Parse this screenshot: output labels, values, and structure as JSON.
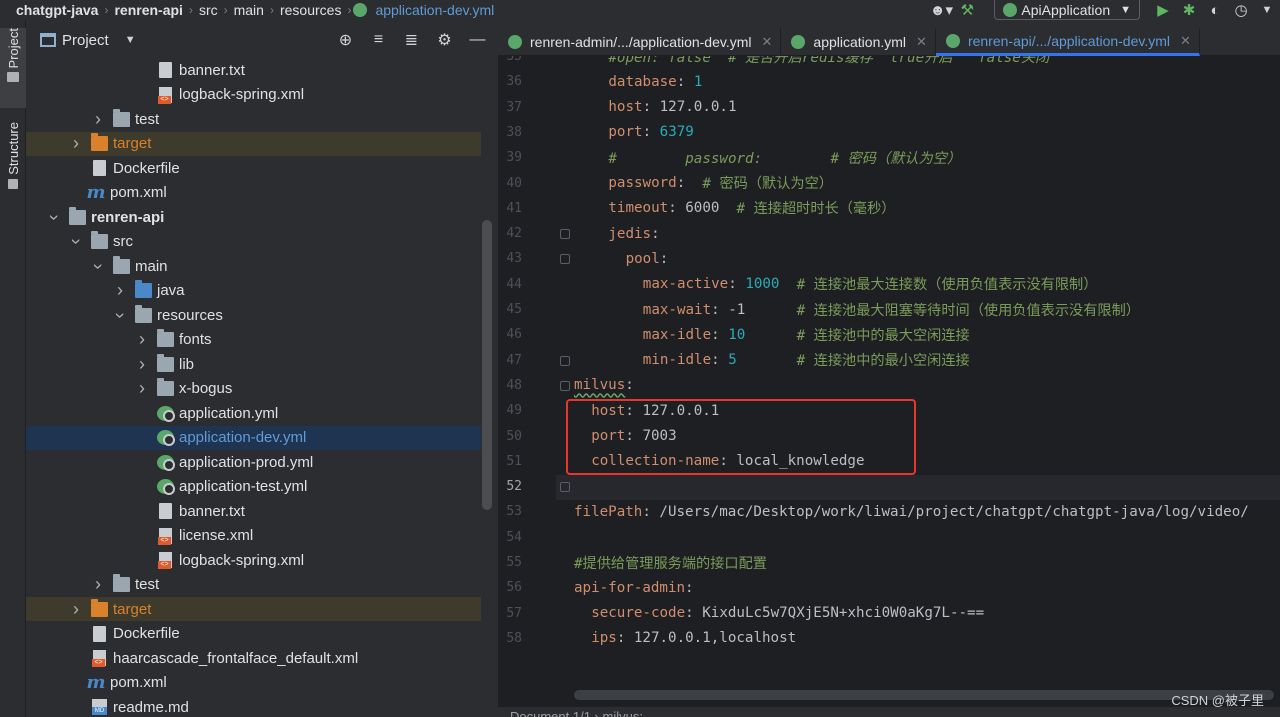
{
  "breadcrumb": [
    {
      "label": "chatgpt-java",
      "bold": true
    },
    {
      "label": "renren-api",
      "bold": true
    },
    {
      "label": "src"
    },
    {
      "label": "main"
    },
    {
      "label": "resources"
    },
    {
      "label": "application-dev.yml",
      "active": true
    }
  ],
  "toolbar": {
    "run_config": "ApiApplication",
    "icons": [
      "user-icon",
      "build-hammer-icon",
      "run-icon",
      "debug-icon",
      "coverage-icon",
      "profiler-icon",
      "more-icon"
    ]
  },
  "left_strip": {
    "project_label": "Project",
    "structure_label": "Structure"
  },
  "project_panel": {
    "title": "Project",
    "tools": [
      "locate-icon",
      "expand-all-icon",
      "collapse-all-icon",
      "settings-icon",
      "hide-icon"
    ]
  },
  "tree": [
    {
      "label": "banner.txt",
      "icon": "text-file-icon",
      "indent": 5,
      "arrow": ""
    },
    {
      "label": "logback-spring.xml",
      "icon": "xml-file-icon",
      "indent": 5,
      "arrow": ""
    },
    {
      "label": "test",
      "icon": "folder-icon",
      "indent": 3,
      "arrow": "right"
    },
    {
      "label": "target",
      "icon": "folder-orange-icon",
      "indent": 2,
      "arrow": "right",
      "style": "orange"
    },
    {
      "label": "Dockerfile",
      "icon": "dockerfile-icon",
      "indent": 2,
      "arrow": ""
    },
    {
      "label": "pom.xml",
      "icon": "maven-icon",
      "indent": 2,
      "arrow": ""
    },
    {
      "label": "renren-api",
      "icon": "module-folder-icon",
      "indent": 1,
      "arrow": "down",
      "bold": true
    },
    {
      "label": "src",
      "icon": "folder-icon",
      "indent": 2,
      "arrow": "down"
    },
    {
      "label": "main",
      "icon": "folder-icon",
      "indent": 3,
      "arrow": "down"
    },
    {
      "label": "java",
      "icon": "source-folder-icon",
      "indent": 4,
      "arrow": "right"
    },
    {
      "label": "resources",
      "icon": "resources-folder-icon",
      "indent": 4,
      "arrow": "down"
    },
    {
      "label": "fonts",
      "icon": "folder-icon",
      "indent": 5,
      "arrow": "right"
    },
    {
      "label": "lib",
      "icon": "folder-icon",
      "indent": 5,
      "arrow": "right"
    },
    {
      "label": "x-bogus",
      "icon": "folder-icon",
      "indent": 5,
      "arrow": "right"
    },
    {
      "label": "application.yml",
      "icon": "spring-yml-icon",
      "indent": 5,
      "arrow": ""
    },
    {
      "label": "application-dev.yml",
      "icon": "spring-yml-icon",
      "indent": 5,
      "arrow": "",
      "selected": true
    },
    {
      "label": "application-prod.yml",
      "icon": "spring-yml-icon",
      "indent": 5,
      "arrow": ""
    },
    {
      "label": "application-test.yml",
      "icon": "spring-yml-icon",
      "indent": 5,
      "arrow": ""
    },
    {
      "label": "banner.txt",
      "icon": "text-file-icon",
      "indent": 5,
      "arrow": ""
    },
    {
      "label": "license.xml",
      "icon": "xml-file-icon",
      "indent": 5,
      "arrow": ""
    },
    {
      "label": "logback-spring.xml",
      "icon": "xml-file-icon",
      "indent": 5,
      "arrow": ""
    },
    {
      "label": "test",
      "icon": "folder-icon",
      "indent": 3,
      "arrow": "right"
    },
    {
      "label": "target",
      "icon": "folder-orange-icon",
      "indent": 2,
      "arrow": "right",
      "style": "orange"
    },
    {
      "label": "Dockerfile",
      "icon": "dockerfile-icon",
      "indent": 2,
      "arrow": ""
    },
    {
      "label": "haarcascade_frontalface_default.xml",
      "icon": "xml-file-icon",
      "indent": 2,
      "arrow": ""
    },
    {
      "label": "pom.xml",
      "icon": "maven-icon",
      "indent": 2,
      "arrow": ""
    },
    {
      "label": "readme.md",
      "icon": "markdown-file-icon",
      "indent": 2,
      "arrow": ""
    }
  ],
  "tabs": [
    {
      "label": "renren-admin/.../application-dev.yml",
      "active": false
    },
    {
      "label": "application.yml",
      "active": false
    },
    {
      "label": "renren-api/.../application-dev.yml",
      "active": true
    }
  ],
  "editor": {
    "current_line": 52,
    "lines": [
      {
        "n": 35,
        "indent": 4,
        "tokens": [
          {
            "t": "#open: false  # 是否开启redis缓存  true开启   false关闭",
            "c": "ci"
          }
        ]
      },
      {
        "n": 36,
        "indent": 4,
        "tokens": [
          {
            "t": "database",
            "c": "k"
          },
          {
            "t": ": ",
            "c": "v"
          },
          {
            "t": "1",
            "c": "n"
          }
        ]
      },
      {
        "n": 37,
        "indent": 4,
        "tokens": [
          {
            "t": "host",
            "c": "k"
          },
          {
            "t": ": 127.0.0.1",
            "c": "v"
          }
        ]
      },
      {
        "n": 38,
        "indent": 4,
        "tokens": [
          {
            "t": "port",
            "c": "k"
          },
          {
            "t": ": ",
            "c": "v"
          },
          {
            "t": "6379",
            "c": "n"
          }
        ]
      },
      {
        "n": 39,
        "indent": 4,
        "tokens": [
          {
            "t": "#        password:        # 密码（默认为空）",
            "c": "ci"
          }
        ]
      },
      {
        "n": 40,
        "indent": 4,
        "tokens": [
          {
            "t": "password",
            "c": "k"
          },
          {
            "t": ":  ",
            "c": "v"
          },
          {
            "t": "# 密码（默认为空）",
            "c": "c"
          }
        ]
      },
      {
        "n": 41,
        "indent": 4,
        "tokens": [
          {
            "t": "timeout",
            "c": "k"
          },
          {
            "t": ": 6000  ",
            "c": "v"
          },
          {
            "t": "# 连接超时时长（毫秒）",
            "c": "c"
          }
        ]
      },
      {
        "n": 42,
        "indent": 4,
        "tokens": [
          {
            "t": "jedis",
            "c": "k"
          },
          {
            "t": ":",
            "c": "v"
          }
        ]
      },
      {
        "n": 43,
        "indent": 6,
        "tokens": [
          {
            "t": "pool",
            "c": "k"
          },
          {
            "t": ":",
            "c": "v"
          }
        ]
      },
      {
        "n": 44,
        "indent": 8,
        "tokens": [
          {
            "t": "max-active",
            "c": "k"
          },
          {
            "t": ": ",
            "c": "v"
          },
          {
            "t": "1000",
            "c": "n"
          },
          {
            "t": "  # 连接池最大连接数（使用负值表示没有限制）",
            "c": "c"
          }
        ]
      },
      {
        "n": 45,
        "indent": 8,
        "tokens": [
          {
            "t": "max-wait",
            "c": "k"
          },
          {
            "t": ": -1      ",
            "c": "v"
          },
          {
            "t": "# 连接池最大阻塞等待时间（使用负值表示没有限制）",
            "c": "c"
          }
        ]
      },
      {
        "n": 46,
        "indent": 8,
        "tokens": [
          {
            "t": "max-idle",
            "c": "k"
          },
          {
            "t": ": ",
            "c": "v"
          },
          {
            "t": "10",
            "c": "n"
          },
          {
            "t": "      # 连接池中的最大空闲连接",
            "c": "c"
          }
        ]
      },
      {
        "n": 47,
        "indent": 8,
        "tokens": [
          {
            "t": "min-idle",
            "c": "k"
          },
          {
            "t": ": ",
            "c": "v"
          },
          {
            "t": "5",
            "c": "n"
          },
          {
            "t": "       # 连接池中的最小空闲连接",
            "c": "c"
          }
        ]
      },
      {
        "n": 48,
        "indent": 0,
        "tokens": [
          {
            "t": "milvus",
            "c": "k wavy"
          },
          {
            "t": ":",
            "c": "v"
          }
        ]
      },
      {
        "n": 49,
        "indent": 2,
        "tokens": [
          {
            "t": "host",
            "c": "k"
          },
          {
            "t": ": 127.0.0.1",
            "c": "v"
          }
        ]
      },
      {
        "n": 50,
        "indent": 2,
        "tokens": [
          {
            "t": "port",
            "c": "k"
          },
          {
            "t": ": 7003",
            "c": "v"
          }
        ]
      },
      {
        "n": 51,
        "indent": 2,
        "tokens": [
          {
            "t": "collection-name",
            "c": "k"
          },
          {
            "t": ": local_knowledge",
            "c": "v"
          }
        ]
      },
      {
        "n": 52,
        "indent": 0,
        "tokens": []
      },
      {
        "n": 53,
        "indent": 0,
        "tokens": [
          {
            "t": "filePath",
            "c": "k"
          },
          {
            "t": ": /Users/mac/Desktop/work/liwai/project/chatgpt/chatgpt-java/log/video/",
            "c": "v"
          }
        ]
      },
      {
        "n": 54,
        "indent": 0,
        "tokens": []
      },
      {
        "n": 55,
        "indent": 0,
        "tokens": [
          {
            "t": "#提供给管理服务端的接口配置",
            "c": "c"
          }
        ]
      },
      {
        "n": 56,
        "indent": 0,
        "tokens": [
          {
            "t": "api-for-admin",
            "c": "k"
          },
          {
            "t": ":",
            "c": "v"
          }
        ]
      },
      {
        "n": 57,
        "indent": 2,
        "tokens": [
          {
            "t": "secure-code",
            "c": "k"
          },
          {
            "t": ": ",
            "c": "v"
          },
          {
            "t": "KixduLc5w7QXjE5N+xhci0W0aKg7L--==",
            "c": "v"
          }
        ]
      },
      {
        "n": 58,
        "indent": 2,
        "tokens": [
          {
            "t": "ips",
            "c": "k"
          },
          {
            "t": ": 127.0.0.1,localhost",
            "c": "v"
          }
        ]
      }
    ]
  },
  "status_bar": {
    "text": "Document 1/1   ›   milvus:"
  },
  "watermark": "CSDN @被子里"
}
